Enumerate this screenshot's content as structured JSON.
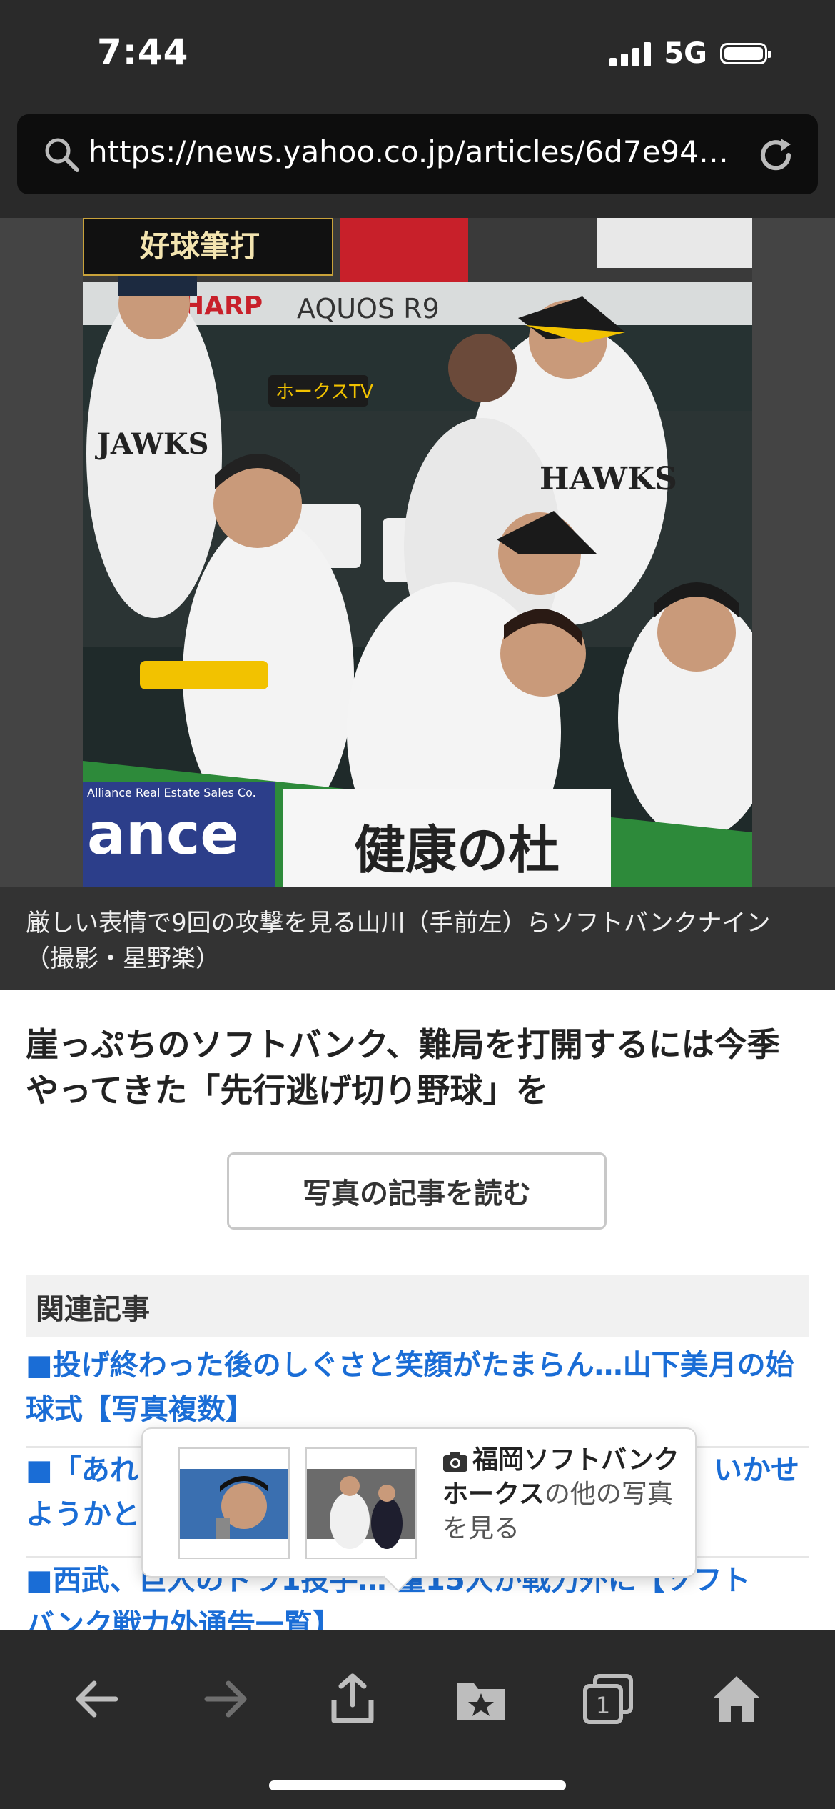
{
  "status_bar": {
    "time": "7:44",
    "network": "5G"
  },
  "browser": {
    "url": "https://news.yahoo.co.jp/articles/6d7e94d…"
  },
  "photo": {
    "overlay_text": "好球筆打",
    "signage": [
      "HARP",
      "AQUOS R9",
      "ホークスTV",
      "ance",
      "健康の杜",
      "Alliance Real Estate Sales Co."
    ]
  },
  "caption": "厳しい表情で9回の攻撃を見る山川（手前左）らソフトバンクナイン（撮影・星野楽）",
  "article": {
    "headline": "崖っぷちのソフトバンク、難局を打開するには今季やってきた「先行逃げ切り野球」を",
    "read_button": "写真の記事を読む"
  },
  "related": {
    "heading": "関連記事",
    "items": [
      "■投げ終わった後のしぐさと笑顔がたまらん…山下美月の始球式【写真複数】",
      "■「あれ",
      "いかせ",
      "ようかと",
      "■西武、巨人のドラ1投手…",
      "量15人が戦力外に【ソフト",
      "バンク戦力外通告一覧】"
    ]
  },
  "popup": {
    "team": "福岡ソフトバンクホークス",
    "suffix": "の他の写真を見る"
  },
  "toolbar": {
    "icons": [
      "back-icon",
      "forward-icon",
      "share-icon",
      "bookmarks-icon",
      "tabs-icon",
      "home-icon"
    ],
    "tab_count": "1"
  }
}
